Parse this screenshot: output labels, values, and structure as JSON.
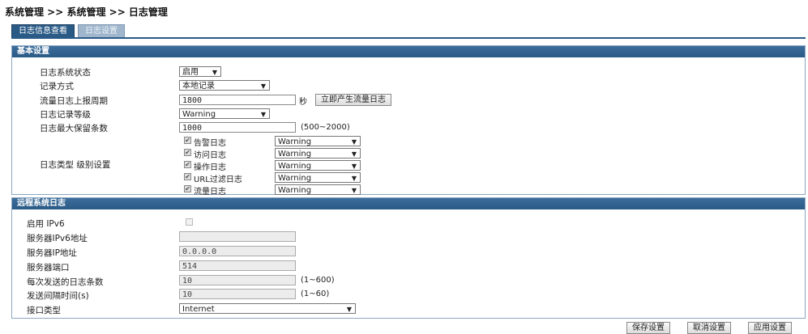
{
  "breadcrumb": "系统管理 >> 系统管理 >> 日志管理",
  "tabs": [
    {
      "label": "日志信息查看"
    },
    {
      "label": "日志设置"
    }
  ],
  "basic": {
    "title": "基本设置",
    "status_label": "日志系统状态",
    "status_value": "启用",
    "method_label": "记录方式",
    "method_value": "本地记录",
    "period_label": "流量日志上报周期",
    "period_value": "1800",
    "period_unit": "秒",
    "gen_button": "立即产生流量日志",
    "level_label": "日志记录等级",
    "level_value": "Warning",
    "max_label": "日志最大保留条数",
    "max_value": "1000",
    "max_hint": "(500~2000)",
    "types_label": "日志类型  级别设置",
    "types": [
      {
        "name": "告警日志",
        "level": "Warning"
      },
      {
        "name": "访问日志",
        "level": "Warning"
      },
      {
        "name": "操作日志",
        "level": "Warning"
      },
      {
        "name": "URL过滤日志",
        "level": "Warning"
      },
      {
        "name": "流量日志",
        "level": "Warning"
      }
    ]
  },
  "remote": {
    "title": "远程系统日志",
    "ipv6_label": "启用 IPv6",
    "ipv6_addr_label": "服务器IPv6地址",
    "ipv6_addr_value": "",
    "ip_label": "服务器IP地址",
    "ip_value": "0.0.0.0",
    "port_label": "服务器端口",
    "port_value": "514",
    "count_label": "每次发送的日志条数",
    "count_value": "10",
    "count_hint": "(1~600)",
    "interval_label": "发送间隔时间(s)",
    "interval_value": "10",
    "interval_hint": "(1~60)",
    "iface_label": "接口类型",
    "iface_value": "Internet"
  },
  "footer": {
    "save": "保存设置",
    "cancel": "取消设置",
    "apply": "应用设置"
  }
}
